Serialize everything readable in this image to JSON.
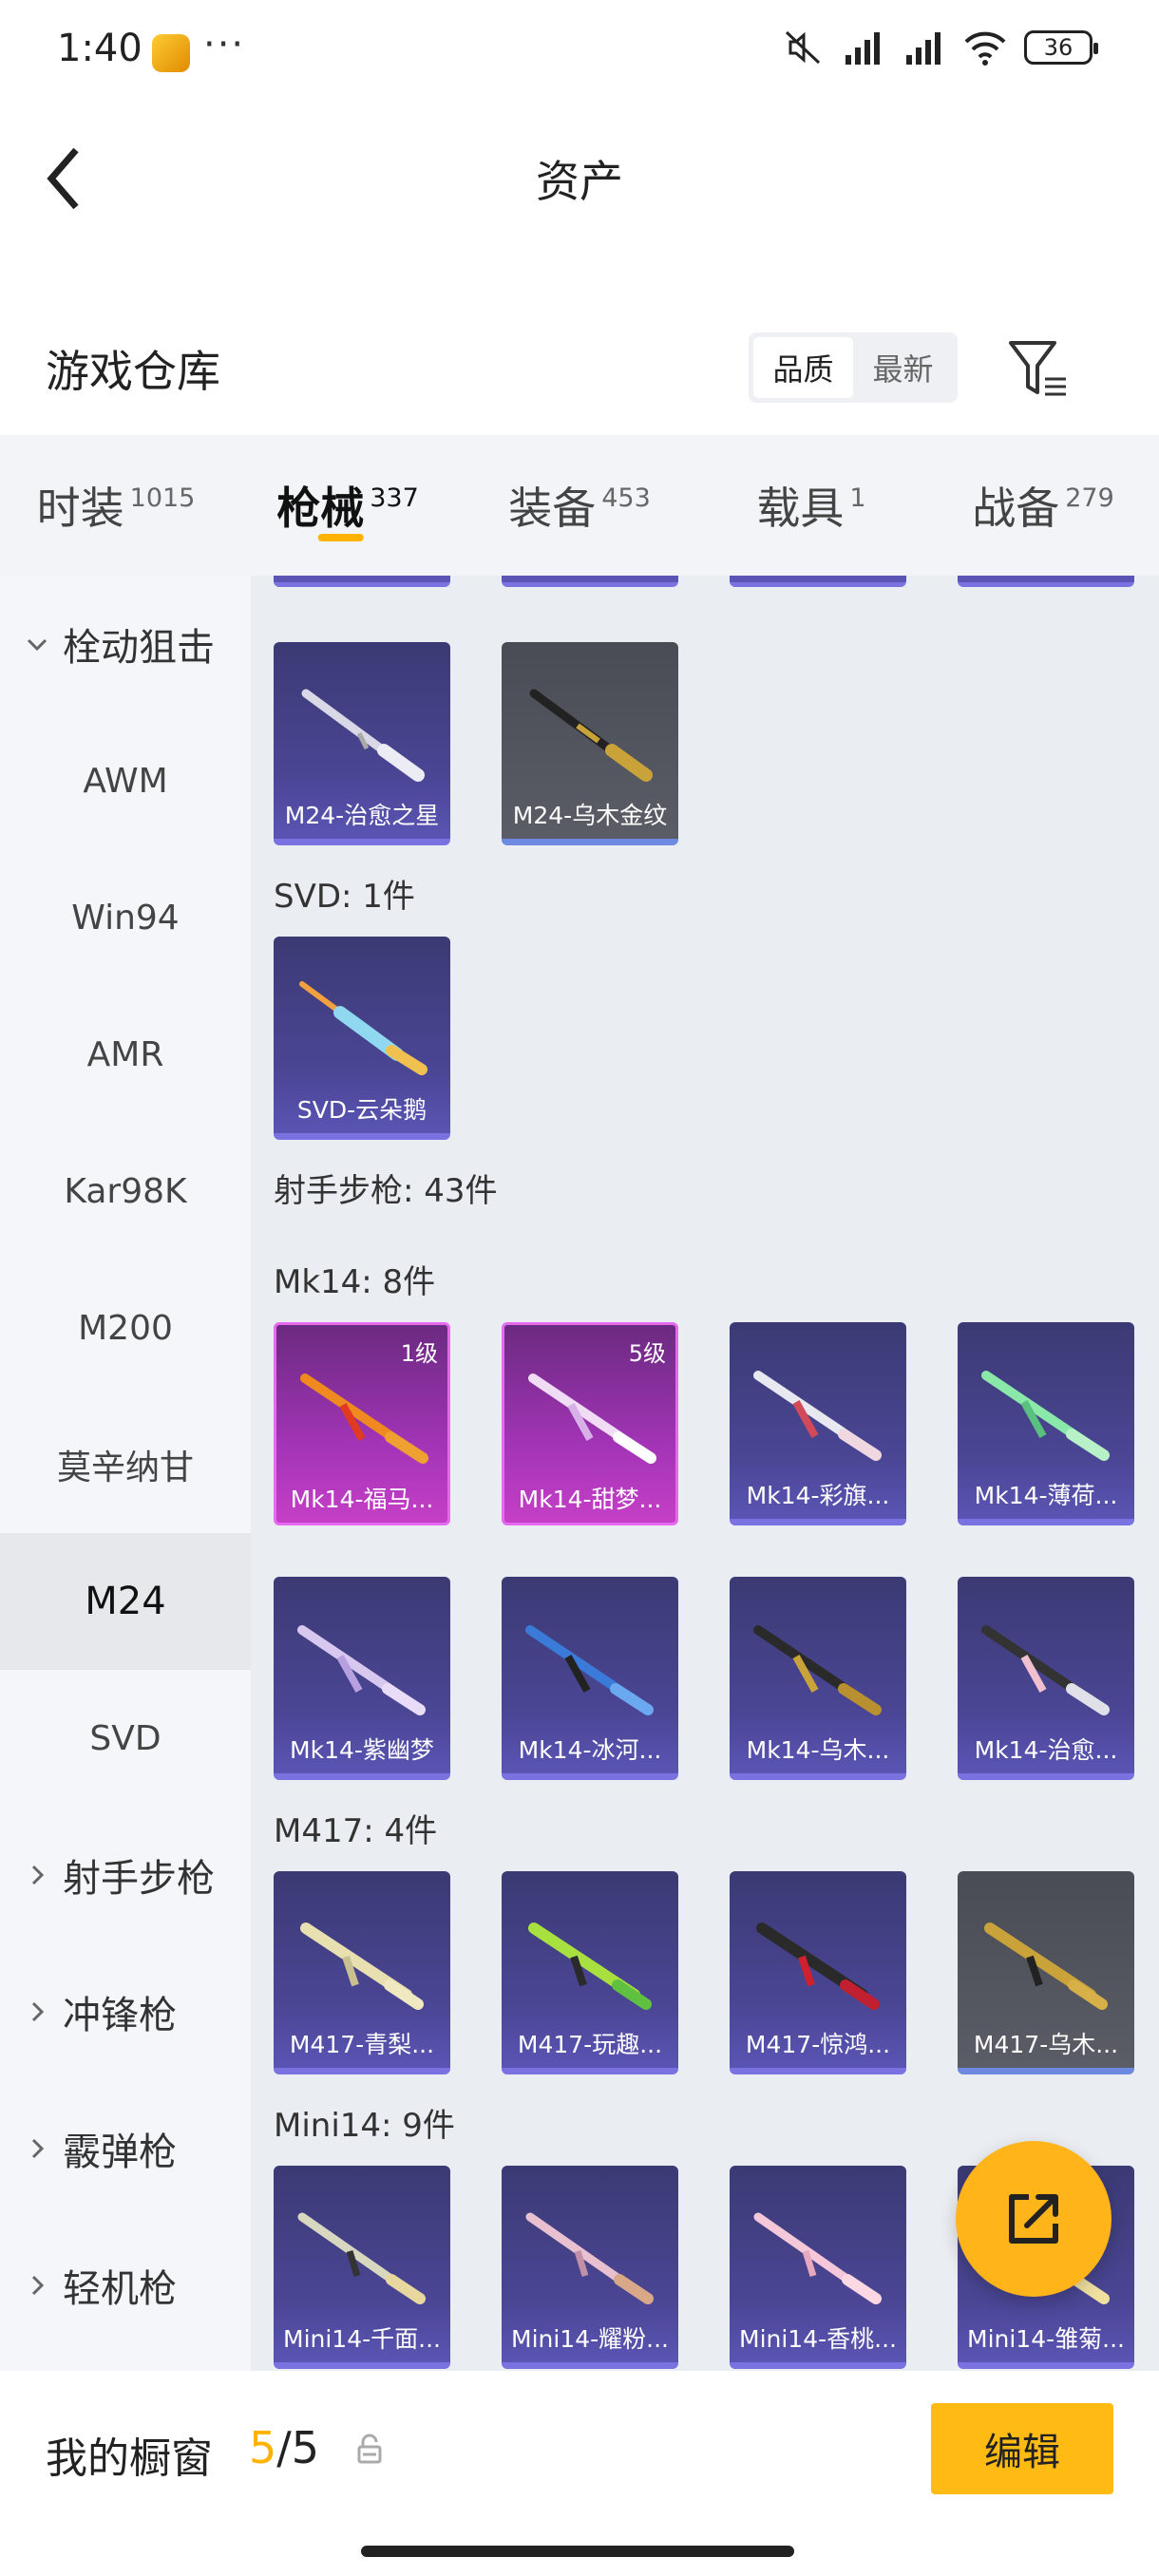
{
  "status_bar": {
    "time": "1:40",
    "more": "···",
    "battery": "36"
  },
  "header": {
    "title": "资产"
  },
  "warehouse": {
    "title": "游戏仓库",
    "sort_options": [
      "品质",
      "最新"
    ],
    "active_sort": "品质"
  },
  "tabs": [
    {
      "label": "时装",
      "count": "1015"
    },
    {
      "label": "枪械",
      "count": "337",
      "active": true
    },
    {
      "label": "装备",
      "count": "453"
    },
    {
      "label": "载具",
      "count": "1"
    },
    {
      "label": "战备",
      "count": "279"
    }
  ],
  "sidebar": {
    "group_bolt": "栓动狙击",
    "items": [
      "AWM",
      "Win94",
      "AMR",
      "Kar98K",
      "M200",
      "莫辛纳甘",
      "M24",
      "SVD"
    ],
    "active_item": "M24",
    "groups": [
      "射手步枪",
      "冲锋枪",
      "霰弹枪",
      "轻机枪"
    ]
  },
  "sections": {
    "svd": "SVD: 1件",
    "dmr": "射手步枪: 43件",
    "mk14": "Mk14: 8件",
    "m417": "M417: 4件",
    "mini14": "Mini14: 9件"
  },
  "cards": {
    "m24": [
      "M24-治愈之星",
      "M24-乌木金纹"
    ],
    "svd": [
      "SVD-云朵鹅"
    ],
    "mk14_row1": [
      "Mk14-福马...",
      "Mk14-甜梦...",
      "Mk14-彩旗...",
      "Mk14-薄荷..."
    ],
    "mk14_row1_levels": [
      "1级",
      "5级"
    ],
    "mk14_row2": [
      "Mk14-紫幽梦",
      "Mk14-冰河...",
      "Mk14-乌木...",
      "Mk14-治愈..."
    ],
    "m417": [
      "M417-青梨...",
      "M417-玩趣...",
      "M417-惊鸿...",
      "M417-乌木..."
    ],
    "mini14": [
      "Mini14-千面...",
      "Mini14-耀粉...",
      "Mini14-香桃...",
      "Mini14-雏菊..."
    ]
  },
  "bottom": {
    "showcase_label": "我的橱窗",
    "showcase_current": "5",
    "showcase_sep": "/",
    "showcase_total": "5",
    "edit_label": "编辑"
  },
  "colors": {
    "accent": "#ffb300",
    "card_purple": "#4b4695",
    "card_pink": "#c53fc6",
    "card_gray": "#5a5c66"
  }
}
